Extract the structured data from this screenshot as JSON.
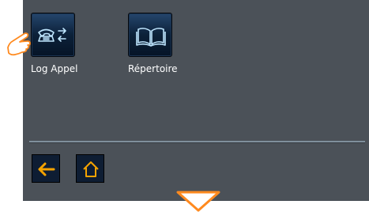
{
  "apps": [
    {
      "label": "Log Appel",
      "icon": "phone-transfer-icon"
    },
    {
      "label": "Répertoire",
      "icon": "open-book-icon"
    }
  ],
  "nav": [
    {
      "icon": "back-arrow-icon"
    },
    {
      "icon": "home-icon"
    }
  ],
  "hint_icon": "pointing-hand-icon",
  "scroll_icon": "scroll-down-triangle-icon",
  "colors": {
    "screen_bg": "#4b5158",
    "icon_glow": "#3aa6ff",
    "nav_accent": "#f5a300",
    "hint_triangle": "#ff8a1f"
  }
}
